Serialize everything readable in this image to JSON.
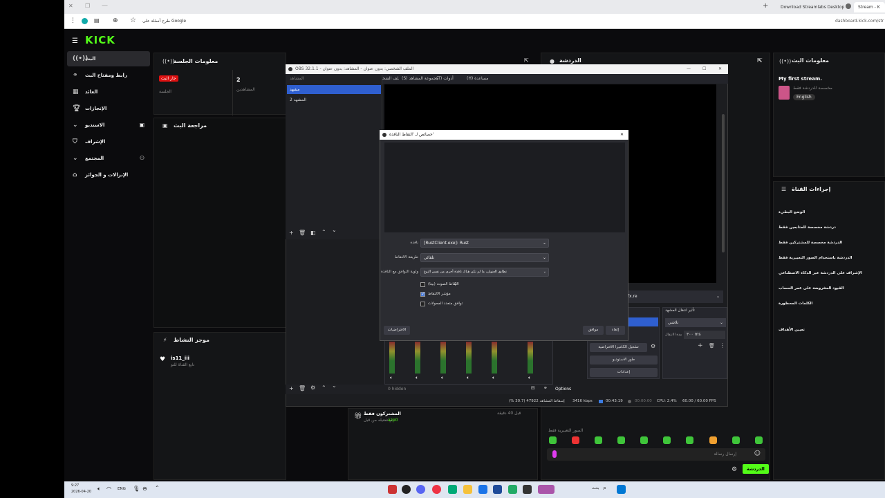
{
  "browser": {
    "tabs": [
      "Download Streamlabs Desktop",
      "Stream - K"
    ],
    "google_hint": "طرح أسئلة على Google",
    "url": "dashboard.kick.com/str"
  },
  "kick": {
    "logo": "KICK",
    "nav": [
      {
        "label": "البث"
      },
      {
        "label": "رابط ومفتاح البث"
      },
      {
        "label": "العائد"
      },
      {
        "label": "الإنجازات"
      },
      {
        "label": "الاستديو"
      },
      {
        "label": "الإشراف"
      },
      {
        "label": "المجتمع"
      },
      {
        "label": "الإنزالات و الجوائز"
      }
    ],
    "session": {
      "title": "معلومات الجلسة",
      "live_badge": "جار البث",
      "session_label": "الجلسة",
      "viewers_value": "2",
      "viewers_label": "المشاهدين"
    },
    "chat": {
      "title": "الدردشة",
      "input_placeholder": "إرسال رسالة",
      "send_button": "الدردشة",
      "emotes_label": "الصور التعبيرية قفط"
    },
    "stream_info": {
      "title": "معلومات البث",
      "stream_title": "My first stream.",
      "category": "مخصصة للدردشة فقط",
      "language": "English"
    },
    "review": {
      "title": "مراجعة البث"
    },
    "activity": {
      "title": "موجز النشاط",
      "user": "is11_iii",
      "desc": "تابع القناة للتو"
    },
    "subscribers": {
      "title": "المشتركون فقط",
      "desc": "تم تفعيله من قبل",
      "user": "azp0",
      "time": "قبل 40 دقيقة"
    },
    "channel_actions": {
      "title": "إجراءات القناة",
      "items": [
        "الوضع البطيء",
        "دردشة مخصصة للمتابعين فقط",
        "الدردشة مخصصة للمشتركين فقط",
        "الدردشة باستخدام الصور التعبيرية فقط",
        "الإشراف على الدردشة عبر الذكاء الاصطناعي",
        "القيود المفروضة على عمر الحساب",
        "الكلمات المحظورة",
        "تعيين الأهداف"
      ]
    }
  },
  "obs": {
    "title": "OBS 32.1.1 - الملف الشخصي: بدون عنوان - المشاهد: بدون عنوان",
    "menu": [
      "(H) مساعدة",
      "(T) أدوات",
      "(S) مجموعة المشاهد",
      "(P) الملف الشخصي"
    ],
    "scenes_header": "المشاهد",
    "scenes": [
      "مشهد",
      "المشهد 2"
    ],
    "transition_title": "تأثير انتقال المشهد",
    "transition_value": "تلاشي",
    "duration_label": "مدة الانتقال",
    "duration_value": "٣٠٠ ms",
    "controls": [
      "تشغيل الكاميرا الافتراضية",
      "طور الاستوديو",
      "إعدادات"
    ],
    "source_partial": "fx.re",
    "hidden_label": "0 hidden",
    "options_label": "Options",
    "status": {
      "frames": "إسقاط المشاهد 47922 (30.7 %)",
      "kbps": "3416 kbps",
      "live_time": "00:43:19",
      "rec_time": "00:00:00",
      "cpu": "CPU: 2.4%",
      "fps": "60.00 / 60.00 FPS"
    }
  },
  "dialog": {
    "title": "خصائص لـ 'التقاط النافذة'",
    "window_label": "نافذة",
    "window_value": "[RustClient.exe]: Rust",
    "method_label": "طريقة الالتقاط",
    "method_value": "تلقائي",
    "priority_label": "أولوية التوافق مع النافذة",
    "priority_value": "تطابق العنوان، ما لم تكن هناك نافذة أخرى من نفس النوع",
    "checks": [
      {
        "label": "التقاط الصوت (بيتا)",
        "checked": false
      },
      {
        "label": "مؤشر الالتقاط",
        "checked": true
      },
      {
        "label": "توافق متعدد المحولات",
        "checked": false
      }
    ],
    "defaults_button": "الافتراضيات",
    "ok_button": "موافق",
    "cancel_button": "إلغاء"
  },
  "taskbar": {
    "time": "9:27",
    "date": "2026-04-20",
    "lang": "ENG",
    "search": "بحث"
  }
}
